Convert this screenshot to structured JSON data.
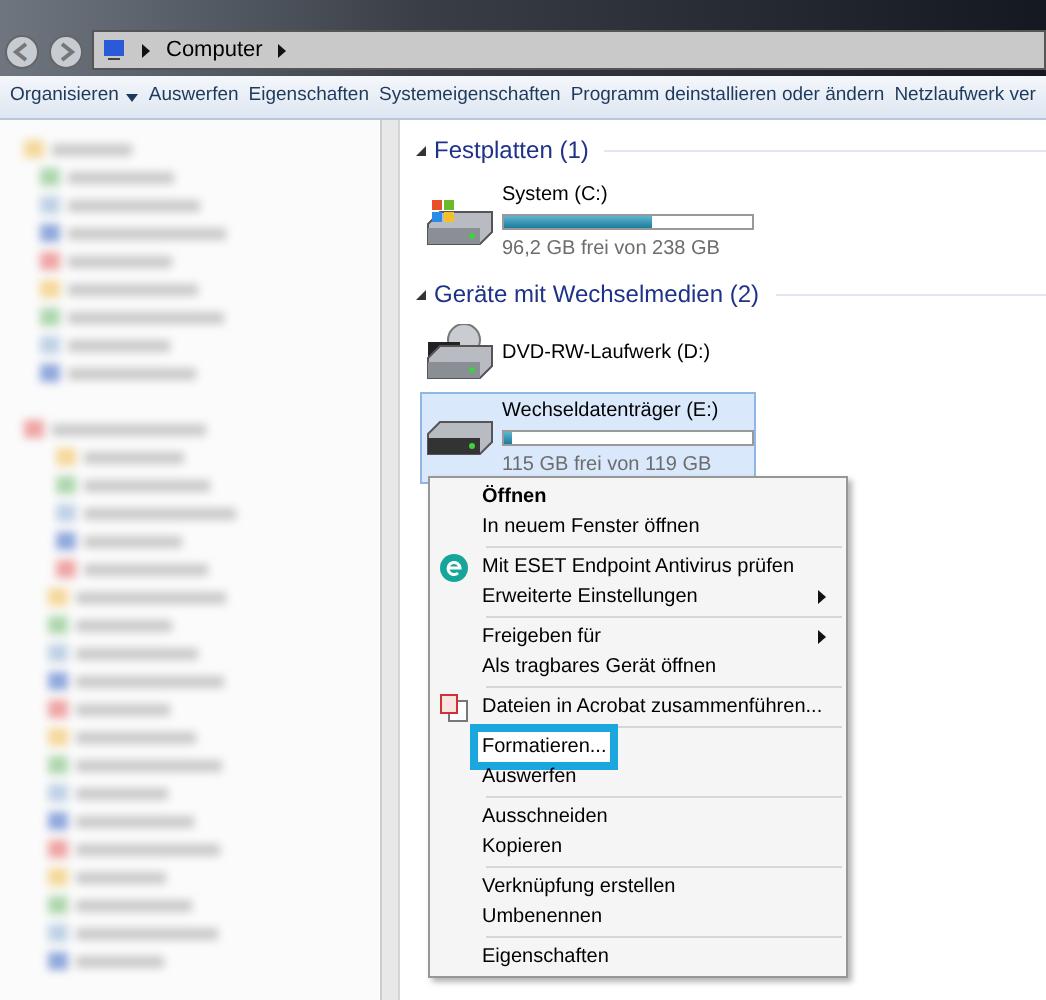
{
  "address_bar": {
    "path": [
      "Computer"
    ]
  },
  "toolbar": {
    "buttons": [
      {
        "label": "Organisieren",
        "dropdown": true
      },
      {
        "label": "Auswerfen",
        "dropdown": false
      },
      {
        "label": "Eigenschaften",
        "dropdown": false
      },
      {
        "label": "Systemeigenschaften",
        "dropdown": false
      },
      {
        "label": "Programm deinstallieren oder ändern",
        "dropdown": false
      },
      {
        "label": "Netzlaufwerk ver",
        "dropdown": false
      }
    ]
  },
  "groups": [
    {
      "title": "Festplatten (1)",
      "expanded": true,
      "drives": [
        {
          "kind": "hdd",
          "name": "System (C:)",
          "level": 0.6,
          "free": "96,2 GB frei von 238 GB",
          "selected": false
        }
      ]
    },
    {
      "title": "Geräte mit Wechselmedien (2)",
      "expanded": true,
      "drives": [
        {
          "kind": "dvd",
          "name": "DVD-RW-Laufwerk (D:)",
          "selected": false
        },
        {
          "kind": "removable",
          "name": "Wechseldatenträger (E:)",
          "level": 0.03,
          "free": "115 GB frei von 119 GB",
          "selected": true
        }
      ]
    }
  ],
  "context_menu": {
    "items": [
      {
        "kind": "item",
        "label": "Öffnen",
        "bold": true
      },
      {
        "kind": "item",
        "label": "In neuem Fenster öffnen"
      },
      {
        "kind": "separator"
      },
      {
        "kind": "antivirus",
        "label": "Mit ESET Endpoint Antivirus prüfen"
      },
      {
        "kind": "item",
        "label": "Erweiterte Einstellungen",
        "submenu": true
      },
      {
        "kind": "separator"
      },
      {
        "kind": "item",
        "label": "Freigeben für",
        "submenu": true
      },
      {
        "kind": "item",
        "label": "Als tragbares Gerät öffnen"
      },
      {
        "kind": "separator"
      },
      {
        "kind": "pdf",
        "label": "Dateien in Acrobat zusammenführen..."
      },
      {
        "kind": "separator"
      },
      {
        "kind": "item",
        "label": "Formatieren...",
        "highlighted": true
      },
      {
        "kind": "item",
        "label": "Auswerfen"
      },
      {
        "kind": "separator"
      },
      {
        "kind": "item",
        "label": "Ausschneiden"
      },
      {
        "kind": "item",
        "label": "Kopieren"
      },
      {
        "kind": "separator"
      },
      {
        "kind": "item",
        "label": "Verknüpfung erstellen"
      },
      {
        "kind": "item",
        "label": "Umbenennen"
      },
      {
        "kind": "separator"
      },
      {
        "kind": "item",
        "label": "Eigenschaften"
      }
    ]
  }
}
